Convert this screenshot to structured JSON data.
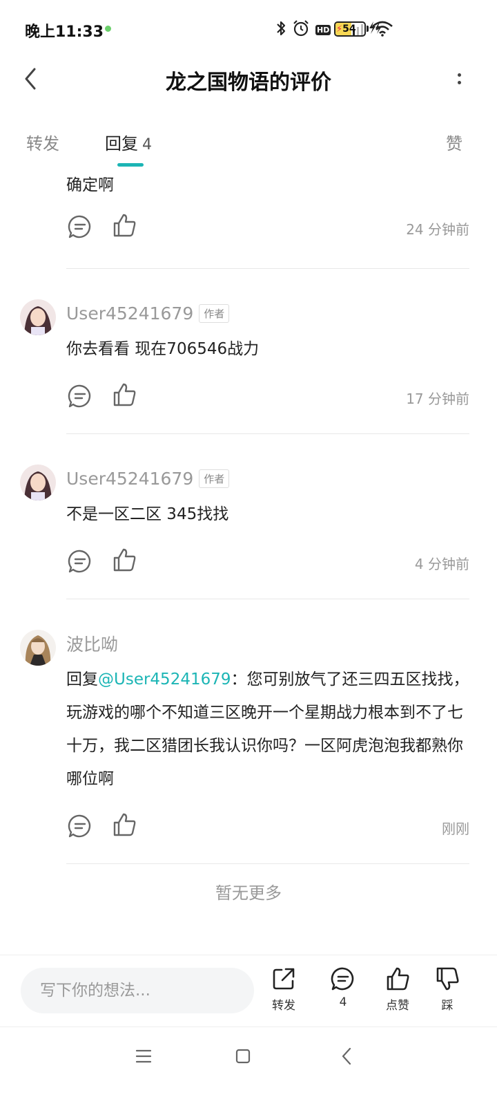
{
  "status_bar": {
    "time": "晚上11:33",
    "network": "4G",
    "hd": "HD",
    "battery_level": "54",
    "battery_fraction": 0.54,
    "charging": true,
    "accent_dot_color": "#6bcf6b"
  },
  "header": {
    "title": "龙之国物语的评价",
    "back_icon": "chevron-left-icon",
    "more_icon": "more-vertical-icon"
  },
  "tabs": {
    "repost": "转发",
    "replies": "回复",
    "replies_count": "4",
    "likes": "赞",
    "active": "replies",
    "indicator_color": "#1cb5b5"
  },
  "replies": [
    {
      "author": "",
      "tag": "",
      "content": "确定啊",
      "time": "24 分钟前"
    },
    {
      "author": "User45241679",
      "tag": "作者",
      "content": "你去看看 现在706546战力",
      "time": "17 分钟前"
    },
    {
      "author": "User45241679",
      "tag": "作者",
      "content": "不是一区二区 345找找",
      "time": "4 分钟前"
    },
    {
      "author": "波比呦",
      "tag": "",
      "reply_prefix": "回复",
      "mention": "@User45241679",
      "content": "：您可别放气了还三四五区找找，玩游戏的哪个不知道三区晚开一个星期战力根本到不了七十万，我二区猎团长我认识你吗？一区阿虎泡泡我都熟你哪位啊",
      "time": "刚刚"
    }
  ],
  "end_text": "暂无更多",
  "bottom_bar": {
    "input_placeholder": "写下你的想法...",
    "share_label": "转发",
    "replies_label": "4",
    "like_label": "点赞",
    "dislike_label": "踩"
  },
  "colors": {
    "accent": "#1cb5b5",
    "muted_text": "#999999"
  }
}
